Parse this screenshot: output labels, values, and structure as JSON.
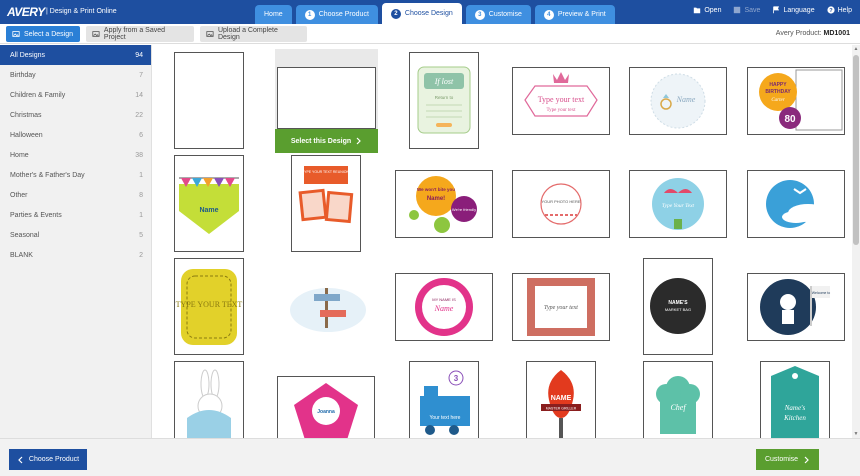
{
  "header": {
    "logo": "AVERY",
    "app_title": "|  Design & Print Online",
    "tabs": [
      {
        "label": "Home",
        "num": ""
      },
      {
        "label": "Choose Product",
        "num": "1"
      },
      {
        "label": "Choose Design",
        "num": "2"
      },
      {
        "label": "Customise",
        "num": "3"
      },
      {
        "label": "Preview & Print",
        "num": "4"
      }
    ],
    "actions": {
      "open": "Open",
      "save": "Save",
      "language": "Language",
      "help": "Help"
    }
  },
  "toolbar": {
    "select_design": "Select a Design",
    "apply_saved": "Apply from a Saved Project",
    "upload_complete": "Upload a Complete Design",
    "product_prefix": "Avery Product:",
    "product_code": "MD1001"
  },
  "sidebar": {
    "categories": [
      {
        "label": "All Designs",
        "count": "94"
      },
      {
        "label": "Birthday",
        "count": "7"
      },
      {
        "label": "Children & Family",
        "count": "14"
      },
      {
        "label": "Christmas",
        "count": "22"
      },
      {
        "label": "Halloween",
        "count": "6"
      },
      {
        "label": "Home",
        "count": "38"
      },
      {
        "label": "Mother's & Father's Day",
        "count": "1"
      },
      {
        "label": "Other",
        "count": "8"
      },
      {
        "label": "Parties & Events",
        "count": "1"
      },
      {
        "label": "Seasonal",
        "count": "5"
      },
      {
        "label": "BLANK",
        "count": "2"
      }
    ]
  },
  "designs": {
    "select_label": "Select this Design",
    "lost_title": "If lost",
    "lost_sub": "Return to",
    "type_text": "Type your text",
    "type_text_lower": "Type your text",
    "name_script": "Name",
    "happy": "HAPPY",
    "birthday": "BIRTHDAY",
    "carter": "Carter",
    "eighty": "80",
    "reunion": "TYPE YOUR TEXT REUNION!",
    "we_wont": "We won't bite you",
    "name_word": "Name!",
    "friendly": "We're friendly",
    "photo_here": "YOUR PHOTO HERE",
    "type_your_text_2": "Type Your Text",
    "type_caps": "TYPE YOUR TEXT",
    "my_name_is": "MY NAME IS",
    "name_caps": "Name",
    "names_bag": "NAME'S",
    "market_bag": "MARKET BAG",
    "welcome": "Welcome to",
    "chef": "Chef",
    "name_s": "Name's",
    "kitchen": "Kitchen",
    "text_here": "Your text here",
    "number_3": "3",
    "name_fire": "NAME",
    "master_griller": "MASTER GRILLER",
    "joanna": "Joanna"
  },
  "footer": {
    "back": "Choose Product",
    "next": "Customise"
  },
  "colors": {
    "brand_blue": "#1e4fa0",
    "tab_blue": "#3f8fe0",
    "action_green": "#5a9e2f"
  }
}
